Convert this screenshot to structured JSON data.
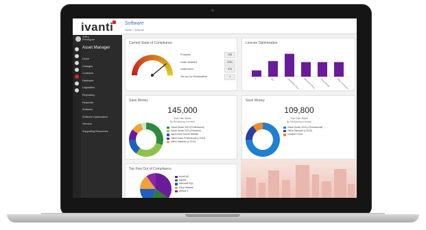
{
  "brand": {
    "name": "ivanti",
    "accent": "#d9262c"
  },
  "user": {
    "name_line1": "Jeffry",
    "name_line2": "Prestiguer"
  },
  "app": {
    "title": "Asset Manager"
  },
  "nav": [
    "Home",
    "Changes",
    "Contracts",
    "Hardware",
    "Legislation",
    "Repository",
    "Requests",
    "Software",
    "Software Optimization",
    "Vendors",
    "Supporting Resources"
  ],
  "header": {
    "title": "Software",
    "breadcrumb_home": "Home",
    "breadcrumb_sep": ">",
    "breadcrumb_current": "Software"
  },
  "compliance": {
    "title": "Current State of Compliance",
    "gauge_value_pct": 0.78,
    "stats": [
      {
        "label": "Products",
        "value": "208"
      },
      {
        "label": "Units Installed",
        "value": "2261"
      },
      {
        "label": "Unlicensed",
        "value": "976"
      },
      {
        "label": "Set Up for Reclamation",
        "value": "4"
      }
    ]
  },
  "license_opt": {
    "title": "License Optimization",
    "chart_data": {
      "type": "bar",
      "categories": [
        "A",
        "Box",
        "LibreOffice Professional",
        "Microsoft Office",
        "Visual Studio",
        "Office Professional"
      ],
      "values": [
        6,
        15,
        22,
        14,
        14,
        14
      ],
      "color": "#6a1b9a"
    }
  },
  "save1": {
    "title": "Save Money",
    "amount": "145,000",
    "label": "You Can Save",
    "sublabel": "By Reclaiming Licenses",
    "chart_data": {
      "type": "pie",
      "donut": true,
      "values": [
        30,
        30,
        15,
        10,
        10,
        5
      ],
      "colors": [
        "#2e8b3e",
        "#8bc34a",
        "#1f5fbf",
        "#6a1b9a",
        "#f0a13a",
        "#c8e6c9"
      ]
    },
    "legend": [
      {
        "text": "Visual Studio 2013 (Professional)",
        "color": "#2e8b3e"
      },
      {
        "text": "Visual Studio 2013 (Premium)",
        "color": "#8bc34a"
      },
      {
        "text": "AppControl Secure Mobility",
        "color": "#1f5fbf"
      },
      {
        "text": "Office Home Professional (x 2013)",
        "color": "#6a1b9a"
      },
      {
        "text": "Office Standard (x 2013)",
        "color": "#f0a13a"
      }
    ]
  },
  "save2": {
    "title": "Save Money",
    "amount": "109,800",
    "label": "You Can Save",
    "sublabel": "By Reclaiming Licenses",
    "chart_data": {
      "type": "pie",
      "donut": true,
      "values": [
        75,
        15,
        10
      ],
      "colors": [
        "#1f7fd1",
        "#2e3f9e",
        "#f08a24"
      ]
    },
    "legend": [
      {
        "text": "Visual Studio 2013 (x Professional)",
        "color": "#1f7fd1"
      },
      {
        "text": "Office Standard (x 2013)",
        "color": "#2e3f9e"
      },
      {
        "text": "Creative Cloud",
        "color": "#f08a24"
      }
    ]
  },
  "top5": {
    "title": "Top Five Out of Compliance",
    "chart_data": {
      "type": "pie",
      "values": [
        35,
        20,
        20,
        15,
        10
      ],
      "colors": [
        "#6a1b9a",
        "#2e7d32",
        "#1f5fbf",
        "#f0a13a",
        "#8e24aa"
      ]
    },
    "legend": [
      {
        "text": "ArchiCAD",
        "color": "#6a1b9a"
      },
      {
        "text": "Agnahr",
        "color": "#2e7d32"
      },
      {
        "text": "Microsoft SQL",
        "color": "#1f5fbf"
      },
      {
        "text": "Easy Notepad",
        "color": "#f0a13a"
      },
      {
        "text": "Aptitud 3",
        "color": "#8e24aa"
      }
    ]
  }
}
